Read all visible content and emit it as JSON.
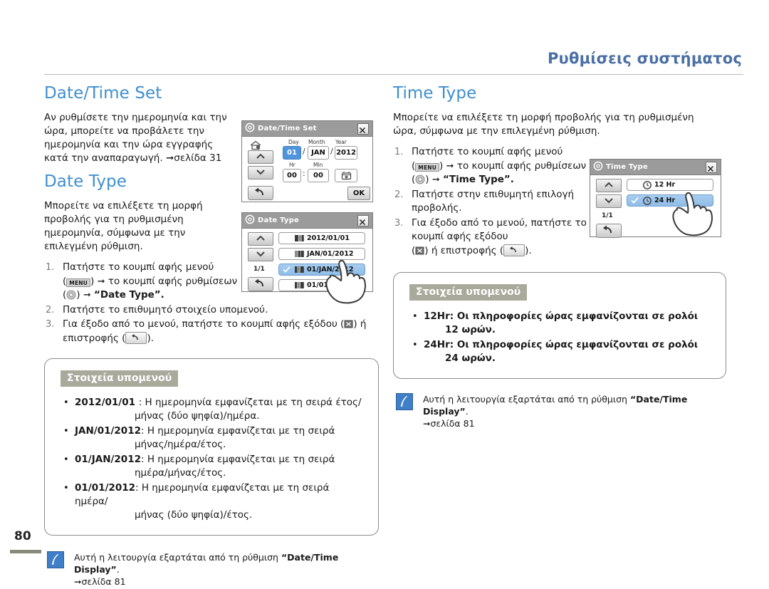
{
  "header": {
    "title": "Ρυθμίσεις συστήματος"
  },
  "page_number": "80",
  "left": {
    "section1_title": "Date/Time Set",
    "section1_body": "Αν ρυθμίσετε την ημερομηνία και την ώρα, μπορείτε να προβάλετε την ημερομηνία και την ώρα εγγραφής κατά την αναπαραγωγή. ➞σελίδα 31",
    "section2_title": "Date Type",
    "section2_body": "Μπορείτε να επιλέξετε τη μορφή προβολής για τη ρυθμισμένη ημερομηνία, σύμφωνα με την επιλεγμένη ρύθμιση.",
    "steps": [
      {
        "num": "1.",
        "part1": "Πατήστε το κουμπί αφής μενού",
        "menu_chip": "MENU",
        "part2": "το κουμπί αφής ρυθμίσεων",
        "part3": "“Date Type”."
      },
      {
        "num": "2.",
        "text": "Πατήστε το επιθυμητό στοιχείο υπομενού."
      },
      {
        "num": "3.",
        "part1": "Για έξοδο από το μενού, πατήστε το κουμπί αφής εξόδου (",
        "part2": ") ή επιστροφής (",
        "part3": ")."
      }
    ],
    "submenu_tag": "Στοιχεία υπομενού",
    "submenu_items": [
      {
        "term": "2012/01/01 ",
        "desc": ": Η ημερομηνία εμφανίζεται με τη σειρά έτος/",
        "desc2": "μήνας (δύο ψηφία)/ημέρα."
      },
      {
        "term": "JAN/01/2012",
        "desc": ": Η ημερομηνία εμφανίζεται με τη σειρά",
        "desc2": "μήνας/ημέρα/έτος."
      },
      {
        "term": "01/JAN/2012",
        "desc": ": Η ημερομηνία εμφανίζεται με τη σειρά",
        "desc2": "ημέρα/μήνας/έτος."
      },
      {
        "term": "01/01/2012",
        "desc": ": Η ημερομηνία εμφανίζεται με τη σειρά ημέρα/",
        "desc2": "μήνας (δύο ψηφία)/έτος."
      }
    ],
    "note_pre": "Αυτή η λειτουργία εξαρτάται από τη ρύθμιση ",
    "note_bold": "“Date/Time Display”",
    "note_post": ".",
    "note_ref": "➞σελίδα 81"
  },
  "right": {
    "section_title": "Time Type",
    "section_body": "Μπορείτε να επιλέξετε τη μορφή προβολής για τη ρυθμισμένη ώρα, σύμφωνα με την επιλεγμένη ρύθμιση.",
    "steps": [
      {
        "num": "1.",
        "part1": "Πατήστε το κουμπί αφής μενού",
        "menu_chip": "MENU",
        "part2": "το κουμπί αφής ρυθμίσεων",
        "part3": "“Time Type”."
      },
      {
        "num": "2.",
        "text": "Πατήστε στην επιθυμητή επιλογή προβολής."
      },
      {
        "num": "3.",
        "part1": "Για έξοδο από το μενού, πατήστε το κουμπί αφής εξόδου",
        "part2": ") ή επιστροφής (",
        "part3": ")."
      }
    ],
    "submenu_tag": "Στοιχεία υπομενού",
    "submenu_items": [
      {
        "term": "12Hr",
        "desc": ": Οι πληροφορίες ώρας εμφανίζονται σε ρολόι",
        "desc2": "12 ωρών."
      },
      {
        "term": "24Hr",
        "desc": ": Οι πληροφορίες ώρας εμφανίζονται σε ρολόι",
        "desc2": "24 ωρών."
      }
    ],
    "note_pre": "Αυτή η λειτουργία εξαρτάται από τη ρύθμιση ",
    "note_bold": "“Date/Time Display”",
    "note_post": ".",
    "note_ref": "➞σελίδα 81"
  },
  "lcd_datetime": {
    "title": "Date/Time Set",
    "labels": {
      "day": "Day",
      "month": "Month",
      "year": "Year",
      "hr": "Hr",
      "min": "Min"
    },
    "values": {
      "day": "01",
      "month": "JAN",
      "year": "2012",
      "hr": "00",
      "min": "00"
    },
    "separators": {
      "date": "/",
      "time": ":"
    },
    "ok_label": "OK"
  },
  "lcd_datetype": {
    "title": "Date Type",
    "page_indicator": "1/1",
    "options": [
      {
        "label": "2012/01/01",
        "selected": false
      },
      {
        "label": "JAN/01/2012",
        "selected": false
      },
      {
        "label": "01/JAN/2012",
        "selected": true
      },
      {
        "label": "01/01/2012",
        "selected": false
      }
    ]
  },
  "lcd_timetype": {
    "title": "Time Type",
    "page_indicator": "1/1",
    "options": [
      {
        "label": "12 Hr",
        "selected": false
      },
      {
        "label": "24 Hr",
        "selected": true
      }
    ]
  },
  "colors": {
    "heading_blue": "#3f8fd0",
    "header_blue": "#4a6fa5",
    "tag_grey": "#a9a99c",
    "select_blue": "#8fbde8",
    "note_blue": "#3f7fc8"
  }
}
